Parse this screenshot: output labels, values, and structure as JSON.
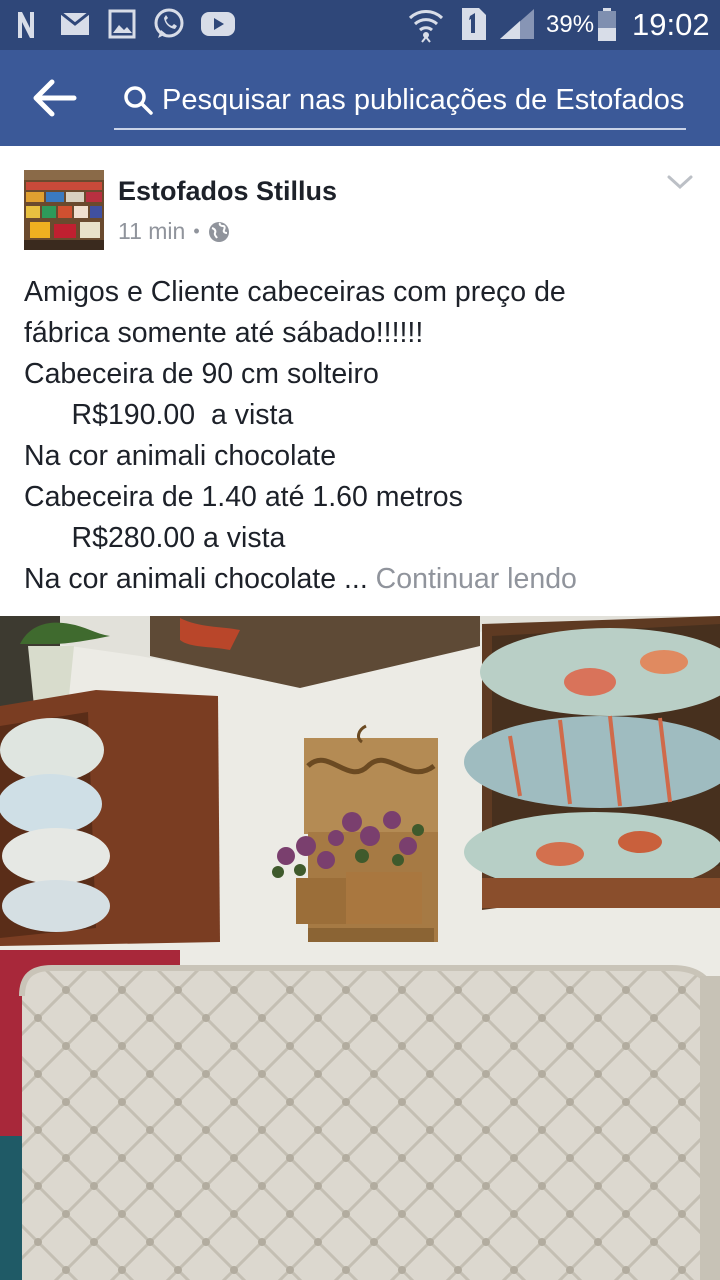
{
  "status_bar": {
    "icons": [
      "n-icon",
      "mail-icon",
      "gallery-icon",
      "whatsapp-icon",
      "youtube-icon",
      "wifi-icon",
      "sim-1-icon",
      "signal-icon",
      "battery-icon"
    ],
    "battery_percent": "39%",
    "time": "19:02",
    "background_color": "#2f4779"
  },
  "header": {
    "background_color": "#3b5998",
    "search_placeholder": "Pesquisar nas publicações de Estofados"
  },
  "post": {
    "page_name": "Estofados Stillus",
    "time_ago": "11 min",
    "separator": "•",
    "audience_icon": "globe-icon",
    "lines": [
      "Amigos e Cliente cabeceiras com preço de",
      "fábrica somente até sábado!!!!!!",
      "Cabeceira de 90 cm solteiro",
      "      R$190.00  a vista",
      "Na cor animali chocolate",
      "Cabeceira de 1.40 até 1.60 metros",
      "      R$280.00 a vista",
      "Na cor animali chocolate ..."
    ],
    "see_more": "Continuar lendo"
  }
}
